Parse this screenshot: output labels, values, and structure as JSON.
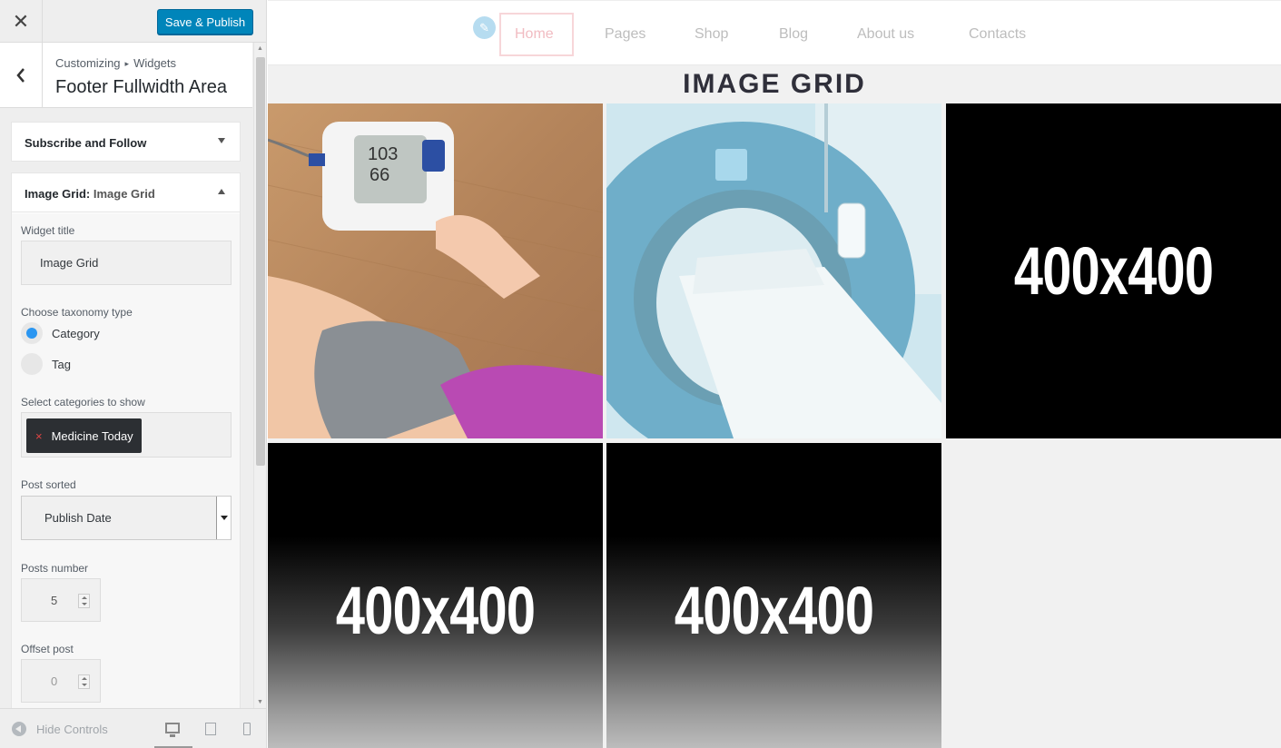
{
  "header": {
    "close_label": "✕",
    "publish_label": "Save & Publish"
  },
  "section": {
    "breadcrumb": [
      "Customizing",
      "Widgets"
    ],
    "breadcrumb_sep": "▸",
    "title": "Footer Fullwidth Area"
  },
  "widgets": {
    "subscribe": {
      "title": "Subscribe and Follow"
    },
    "image_grid": {
      "type": "Image Grid:",
      "instance": "Image Grid",
      "fields": {
        "widget_title_label": "Widget title",
        "widget_title_value": "Image Grid",
        "taxonomy_label": "Choose taxonomy type",
        "taxonomy_options": [
          {
            "label": "Category",
            "selected": true
          },
          {
            "label": "Tag",
            "selected": false
          }
        ],
        "categories_label": "Select categories to show",
        "categories_selected": [
          "Medicine Today"
        ],
        "chip_remove": "×",
        "sorted_label": "Post sorted",
        "sorted_value": "Publish Date",
        "posts_number_label": "Posts number",
        "posts_number_value": "5",
        "offset_label": "Offset post",
        "offset_value": "0"
      }
    }
  },
  "footer": {
    "hide_controls_label": "Hide Controls"
  },
  "preview": {
    "nav": {
      "edit_icon": "✎",
      "items": [
        {
          "label": "Home",
          "active": true
        },
        {
          "label": "Pages",
          "active": false
        },
        {
          "label": "Shop",
          "active": false
        },
        {
          "label": "Blog",
          "active": false
        },
        {
          "label": "About us",
          "active": false
        },
        {
          "label": "Contacts",
          "active": false
        }
      ]
    },
    "grid_title": "IMAGE GRID",
    "tiles": [
      {
        "kind": "photo",
        "subject": "blood-pressure-monitor"
      },
      {
        "kind": "photo",
        "subject": "mri-scanner"
      },
      {
        "kind": "placeholder",
        "text": "400x400"
      },
      {
        "kind": "placeholder",
        "text": "400x400"
      },
      {
        "kind": "placeholder",
        "text": "400x400"
      }
    ]
  },
  "colors": {
    "publish": "#0085ba",
    "radio_on": "#2b96f1",
    "chip_bg": "#2c2f33",
    "chip_remove": "#e04444",
    "nav_active": "#f1bcc2"
  }
}
